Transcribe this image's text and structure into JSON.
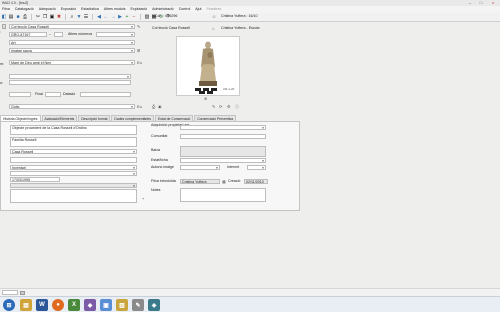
{
  "window": {
    "title": "IMU2 4.0 - [Imu2]"
  },
  "menu": [
    "Fitxa",
    "Catalogació",
    "Adequació",
    "Exposició",
    "Estadística",
    "Altres mòduls",
    "Explotació",
    "Administració",
    "Control",
    "Ajut",
    "Finestres"
  ],
  "record": {
    "id_label": "IdCol I : 696296",
    "museum": "Col·lecció Casa Rossell",
    "museum_right": "Col·lecció Casa Rossell",
    "user": "Cristina Yuftera : 16/10",
    "user_right": "Cristina Yuftera - Escola",
    "inventory_number": "GRO-87167",
    "other_numbers_label": "Altres números",
    "art_field": "Art",
    "object_name": "Imatge sacra",
    "title": "Mare de Déu amb el Nen",
    "date_final_label": "Final",
    "dating_label": "Datació",
    "style": "Gòtic"
  },
  "photo": {
    "caption": "CR-1-20",
    "alt": "Escultura gòtica de la Mare de Déu amb el Nen"
  },
  "tabs": [
    "Història Objecte/Ingrés",
    "Avaluació/Elements",
    "Descripció formal",
    "Dades complementàries",
    "Estat de Conservació",
    "Conservació Preventiva"
  ],
  "history": {
    "historia_value": "Objecte procedent de la Casa Rossell d'Ordino",
    "propietari_value": "Familia Rossell",
    "origin_value": "Casa Rossell",
    "ingres_value": "Inventari",
    "date_value": "17/03/1995"
  },
  "right_panel": {
    "adquisicio_label": "Adquisició propietari ant.",
    "comunitat_label": "Comunitat",
    "baixa_label": "Baixa",
    "estat_label": "Estat/ficha",
    "autoritzacio_label": "Autoriz.imatge",
    "internet_label": "Internet",
    "fitxa_label": "Fitxa introduïda",
    "fitxa_value": "Cristina Yuftera",
    "creacio_label": "Creació",
    "creacio_value": "02/11/2010",
    "notes_label": "Notes"
  },
  "taskbar_apps": [
    "start",
    "explorer",
    "firefox",
    "word",
    "excel",
    "paint",
    "imu",
    "notes",
    "folder",
    "app"
  ]
}
